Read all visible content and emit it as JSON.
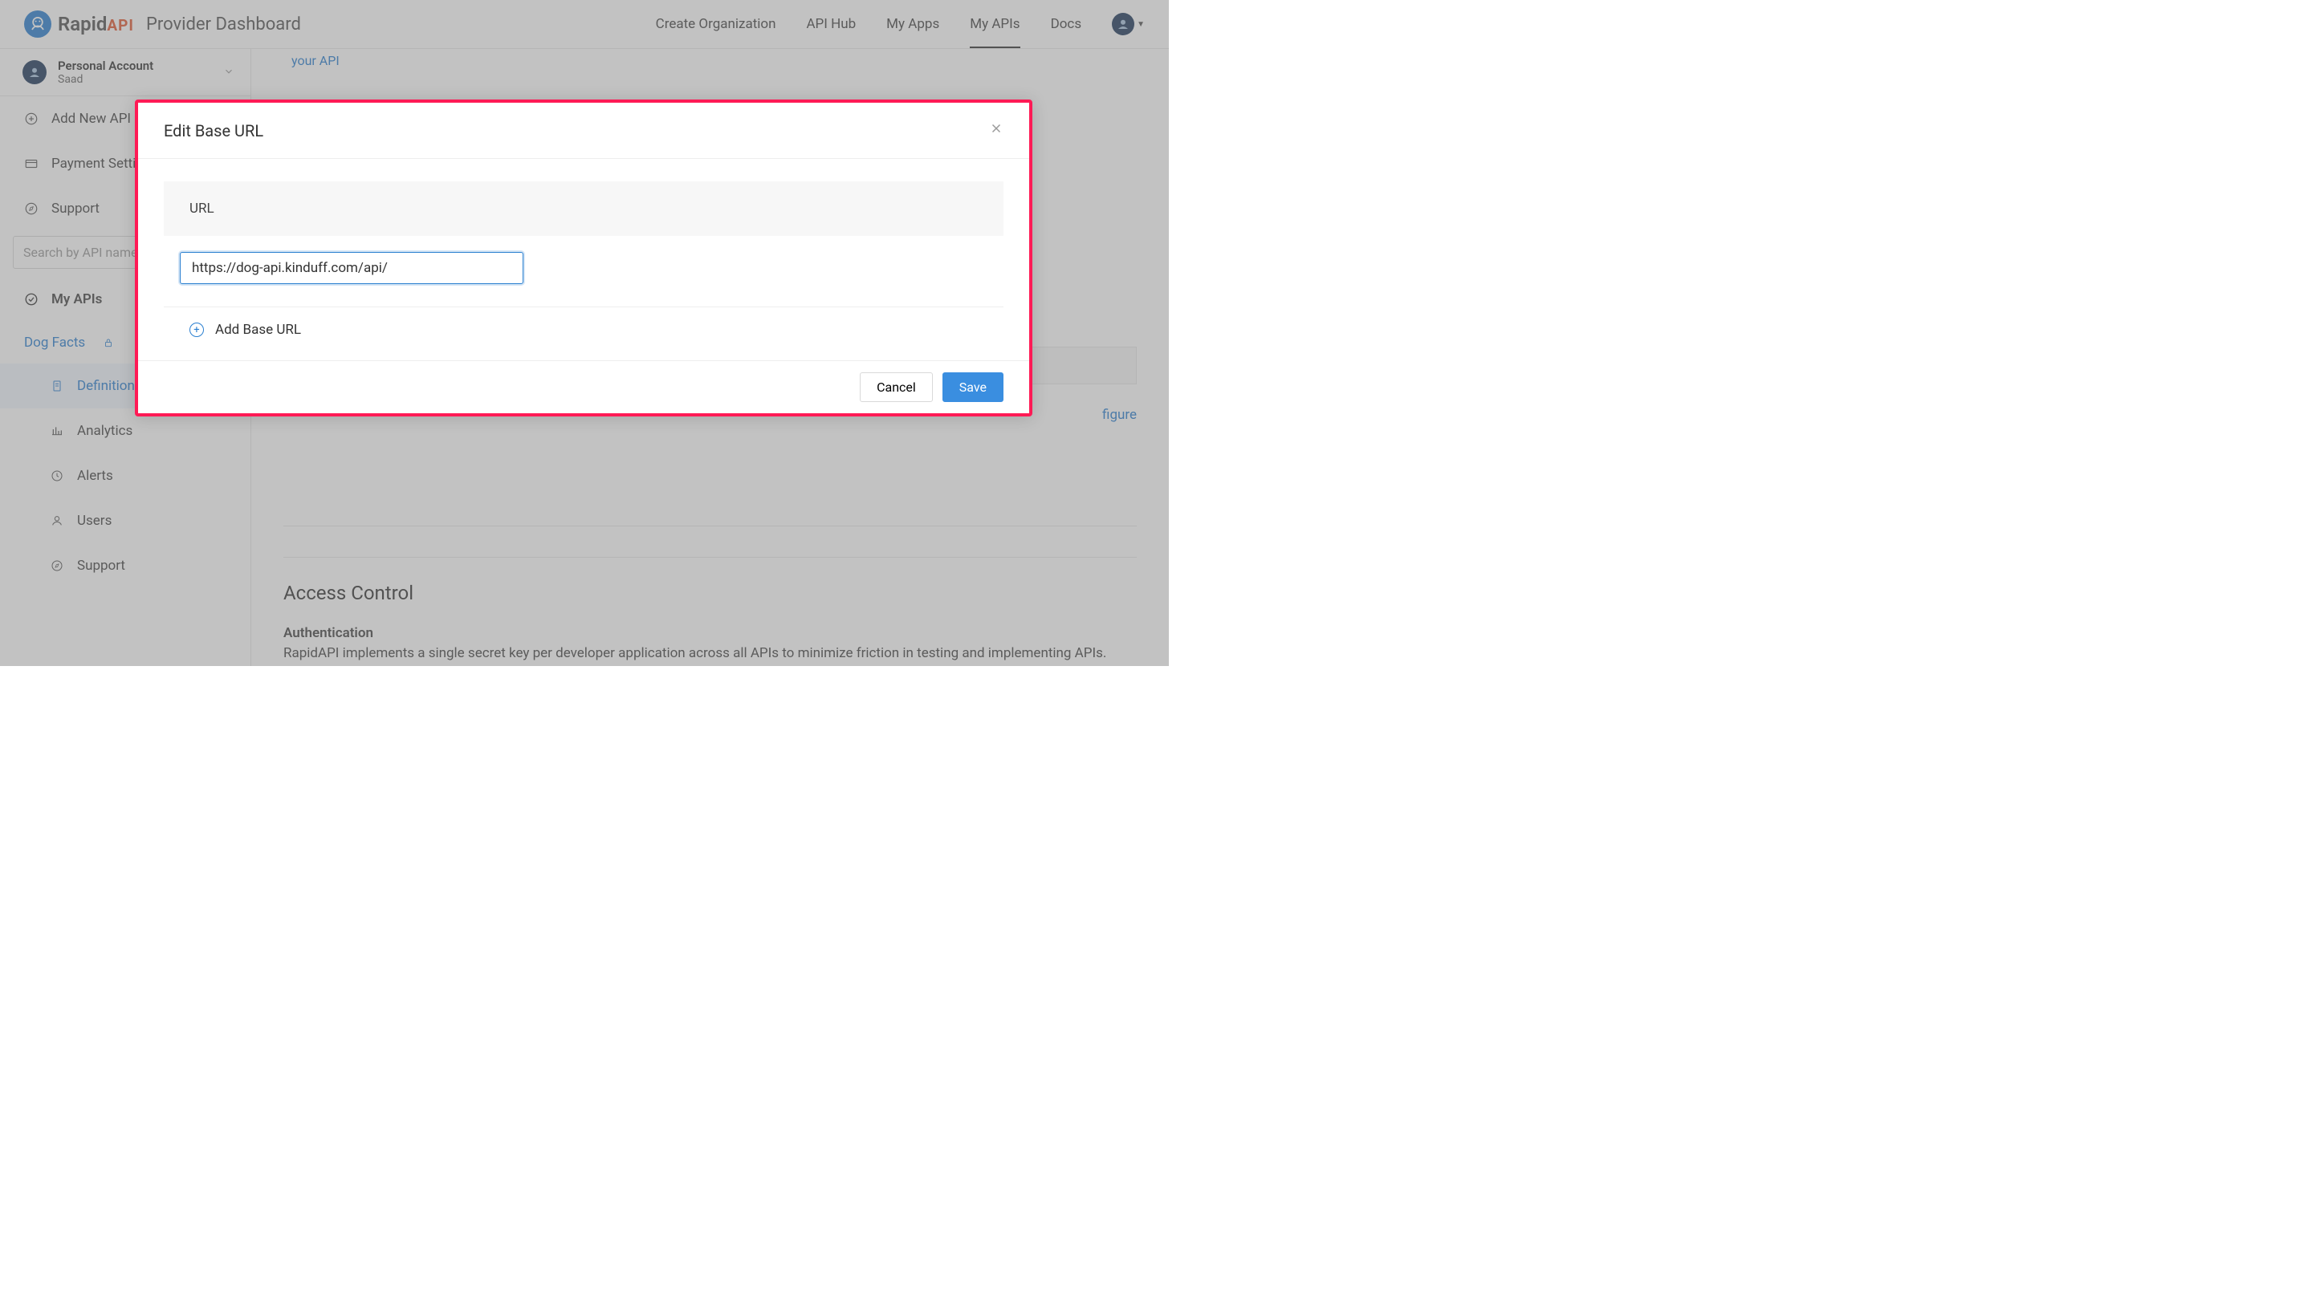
{
  "header": {
    "logo_text": "Rapid",
    "logo_api": "API",
    "title": "Provider Dashboard",
    "nav": {
      "create_org": "Create Organization",
      "api_hub": "API Hub",
      "my_apps": "My Apps",
      "my_apis": "My APIs",
      "docs": "Docs"
    }
  },
  "sidebar": {
    "account": {
      "title": "Personal Account",
      "user": "Saad"
    },
    "add_new": "Add New API",
    "payment": "Payment Settings",
    "support_top": "Support",
    "search_placeholder": "Search by API name",
    "my_apis": "My APIs",
    "dog_facts": "Dog Facts",
    "definition": "Definition",
    "analytics": "Analytics",
    "alerts": "Alerts",
    "users": "Users",
    "support_bottom": "Support"
  },
  "content": {
    "your_api_link": "your API",
    "configure_frag": "figure",
    "access_control_title": "Access Control",
    "auth_heading": "Authentication",
    "auth_desc": "RapidAPI implements a single secret key per developer application across all APIs to minimize friction in testing and implementing APIs."
  },
  "modal": {
    "title": "Edit Base URL",
    "url_header": "URL",
    "url_value": "https://dog-api.kinduff.com/api/",
    "add_base": "Add Base URL",
    "cancel": "Cancel",
    "save": "Save"
  }
}
